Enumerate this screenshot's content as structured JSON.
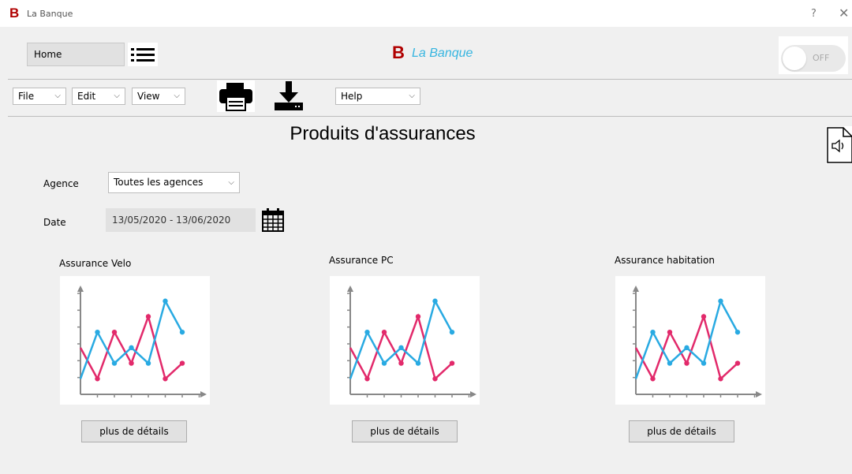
{
  "window": {
    "logo": "B",
    "title": "La Banque",
    "help": "?",
    "close": "✕"
  },
  "header": {
    "home_label": "Home",
    "brand_letter": "B",
    "brand_name": "La Banque",
    "toggle_label": "OFF",
    "menu_icon": "hamburger-list-icon"
  },
  "menubar": {
    "file": "File",
    "edit": "Edit",
    "view": "View",
    "help": "Help",
    "print_icon": "printer-icon",
    "download_icon": "download-icon"
  },
  "page": {
    "title": "Produits d'assurances",
    "agence_label": "Agence",
    "agence_value": "Toutes les agences",
    "date_label": "Date",
    "date_value": "13/05/2020 - 13/06/2020",
    "calendar_icon": "calendar-icon",
    "speaker_icon": "speaker-icon"
  },
  "cards": [
    {
      "title": "Assurance Velo",
      "button": "plus de détails"
    },
    {
      "title": "Assurance PC",
      "button": "plus de détails"
    },
    {
      "title": "Assurance habitation",
      "button": "plus de détails"
    }
  ],
  "colors": {
    "brand_red": "#b00000",
    "brand_blue": "#36b5e0",
    "series_blue": "#29aae2",
    "series_pink": "#e22a6b"
  },
  "chart_data": {
    "type": "line",
    "x": [
      1,
      2,
      3,
      4,
      5,
      6,
      7
    ],
    "series": [
      {
        "values": [
          1,
          4,
          2,
          3,
          2,
          6,
          4
        ],
        "color": "#29aae2"
      },
      {
        "values": [
          3,
          1,
          4,
          2,
          5,
          1,
          2
        ],
        "color": "#e22a6b"
      }
    ],
    "ylim": [
      0,
      7
    ],
    "grid": false
  }
}
